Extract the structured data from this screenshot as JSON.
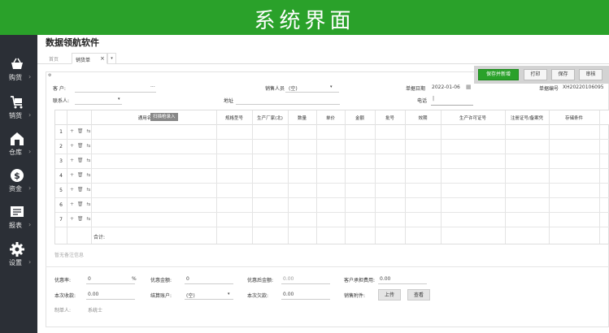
{
  "banner": {
    "title": "系统界面"
  },
  "colors": {
    "brand": "#2aa12a",
    "sidebar": "#2b2f36"
  },
  "sidebar": {
    "items": [
      {
        "label": "购货",
        "icon": "basket-icon"
      },
      {
        "label": "销货",
        "icon": "cart-icon"
      },
      {
        "label": "仓库",
        "icon": "warehouse-icon"
      },
      {
        "label": "资金",
        "icon": "money-icon"
      },
      {
        "label": "报表",
        "icon": "report-icon"
      },
      {
        "label": "设置",
        "icon": "gear-icon"
      }
    ],
    "arrow": "›"
  },
  "app": {
    "title": "数据领航软件"
  },
  "tabs": {
    "home": "首页",
    "active": "销货单",
    "close": "×",
    "more": "▾"
  },
  "toolbar": {
    "save_new": "保存并新增",
    "print": "打印",
    "save": "保存",
    "audit": "审核"
  },
  "form": {
    "customer_label": "客 户:",
    "customer_more": "···",
    "salesperson_label": "销售人员",
    "salesperson_value": "(空)",
    "date_label": "单据日期",
    "date_value": "2022-01-06",
    "docno_label": "单据编号",
    "docno_value": "XH20220106095",
    "contact_label": "联系人:",
    "address_label": "地址",
    "phone_label": "电话",
    "phone_value": "|"
  },
  "grid": {
    "headers": [
      "通用名",
      "规格型号",
      "生产厂家(北)",
      "数量",
      "单价",
      "金额",
      "批号",
      "效期",
      "生产许可证号",
      "注册证号/备案凭",
      "存储条件"
    ],
    "scan_tag": "扫描枪录入",
    "rows": [
      "1",
      "2",
      "3",
      "4",
      "5",
      "6",
      "7"
    ],
    "row_icons": "+ 🗑 ⇆",
    "total_label": "合计:"
  },
  "remark": {
    "placeholder": "暂无备注信息"
  },
  "footer": {
    "discount_rate_label": "优惠率:",
    "discount_rate_value": "0",
    "percent": "%",
    "discount_amount_label": "优惠金额:",
    "discount_amount_value": "0",
    "after_discount_label": "优惠后金额:",
    "after_discount_value": "0.00",
    "customer_fee_label": "客户承担费用:",
    "customer_fee_value": "0.00",
    "received_label": "本次收款:",
    "received_value": "0.00",
    "settle_account_label": "结算账户:",
    "settle_account_value": "(空)",
    "arrears_label": "本次欠款:",
    "arrears_value": "0.00",
    "attachment_label": "销售附件:",
    "upload": "上传",
    "view": "查看",
    "maker_label": "制单人:",
    "maker_value": "系统士"
  }
}
